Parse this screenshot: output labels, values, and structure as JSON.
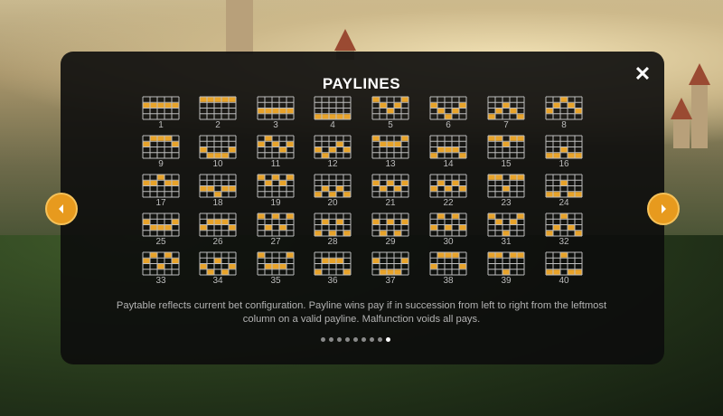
{
  "title": "PAYLINES",
  "close_icon": "close-icon",
  "nav": {
    "prev_icon": "chevron-left-icon",
    "next_icon": "chevron-right-icon"
  },
  "colors": {
    "accent": "#e79a1e",
    "line_on": "#e8a32a",
    "line_off": "#bdbdbd",
    "panel": "#0c0c0c"
  },
  "paylines": [
    {
      "n": "1",
      "rows": [
        1,
        1,
        1,
        1,
        1
      ]
    },
    {
      "n": "2",
      "rows": [
        0,
        0,
        0,
        0,
        0
      ]
    },
    {
      "n": "3",
      "rows": [
        2,
        2,
        2,
        2,
        2
      ]
    },
    {
      "n": "4",
      "rows": [
        3,
        3,
        3,
        3,
        3
      ]
    },
    {
      "n": "5",
      "rows": [
        0,
        1,
        2,
        1,
        0
      ]
    },
    {
      "n": "6",
      "rows": [
        1,
        2,
        3,
        2,
        1
      ]
    },
    {
      "n": "7",
      "rows": [
        3,
        2,
        1,
        2,
        3
      ]
    },
    {
      "n": "8",
      "rows": [
        2,
        1,
        0,
        1,
        2
      ]
    },
    {
      "n": "9",
      "rows": [
        1,
        0,
        0,
        0,
        1
      ]
    },
    {
      "n": "10",
      "rows": [
        2,
        3,
        3,
        3,
        2
      ]
    },
    {
      "n": "11",
      "rows": [
        1,
        0,
        1,
        2,
        1
      ]
    },
    {
      "n": "12",
      "rows": [
        2,
        3,
        2,
        1,
        2
      ]
    },
    {
      "n": "13",
      "rows": [
        0,
        1,
        1,
        1,
        0
      ]
    },
    {
      "n": "14",
      "rows": [
        3,
        2,
        2,
        2,
        3
      ]
    },
    {
      "n": "15",
      "rows": [
        0,
        0,
        1,
        0,
        0
      ]
    },
    {
      "n": "16",
      "rows": [
        3,
        3,
        2,
        3,
        3
      ]
    },
    {
      "n": "17",
      "rows": [
        1,
        1,
        0,
        1,
        1
      ]
    },
    {
      "n": "18",
      "rows": [
        2,
        2,
        3,
        2,
        2
      ]
    },
    {
      "n": "19",
      "rows": [
        0,
        1,
        0,
        1,
        0
      ]
    },
    {
      "n": "20",
      "rows": [
        3,
        2,
        3,
        2,
        3
      ]
    },
    {
      "n": "21",
      "rows": [
        1,
        2,
        1,
        2,
        1
      ]
    },
    {
      "n": "22",
      "rows": [
        2,
        1,
        2,
        1,
        2
      ]
    },
    {
      "n": "23",
      "rows": [
        0,
        0,
        2,
        0,
        0
      ]
    },
    {
      "n": "24",
      "rows": [
        3,
        3,
        1,
        3,
        3
      ]
    },
    {
      "n": "25",
      "rows": [
        1,
        2,
        2,
        2,
        1
      ]
    },
    {
      "n": "26",
      "rows": [
        2,
        1,
        1,
        1,
        2
      ]
    },
    {
      "n": "27",
      "rows": [
        0,
        2,
        0,
        2,
        0
      ]
    },
    {
      "n": "28",
      "rows": [
        3,
        1,
        3,
        1,
        3
      ]
    },
    {
      "n": "29",
      "rows": [
        1,
        3,
        1,
        3,
        1
      ]
    },
    {
      "n": "30",
      "rows": [
        2,
        0,
        2,
        0,
        2
      ]
    },
    {
      "n": "31",
      "rows": [
        0,
        1,
        3,
        1,
        0
      ]
    },
    {
      "n": "32",
      "rows": [
        3,
        2,
        0,
        2,
        3
      ]
    },
    {
      "n": "33",
      "rows": [
        1,
        0,
        2,
        0,
        1
      ]
    },
    {
      "n": "34",
      "rows": [
        2,
        3,
        1,
        3,
        2
      ]
    },
    {
      "n": "35",
      "rows": [
        0,
        2,
        2,
        2,
        0
      ]
    },
    {
      "n": "36",
      "rows": [
        3,
        1,
        1,
        1,
        3
      ]
    },
    {
      "n": "37",
      "rows": [
        1,
        3,
        3,
        3,
        1
      ]
    },
    {
      "n": "38",
      "rows": [
        2,
        0,
        0,
        0,
        2
      ]
    },
    {
      "n": "39",
      "rows": [
        0,
        0,
        3,
        0,
        0
      ]
    },
    {
      "n": "40",
      "rows": [
        3,
        3,
        0,
        3,
        3
      ]
    }
  ],
  "description": "Paytable reflects current bet configuration.  Payline wins pay if in succession from left to right from the leftmost column on a valid payline.  Malfunction voids all pays.",
  "pagination": {
    "count": 9,
    "active": 8
  }
}
